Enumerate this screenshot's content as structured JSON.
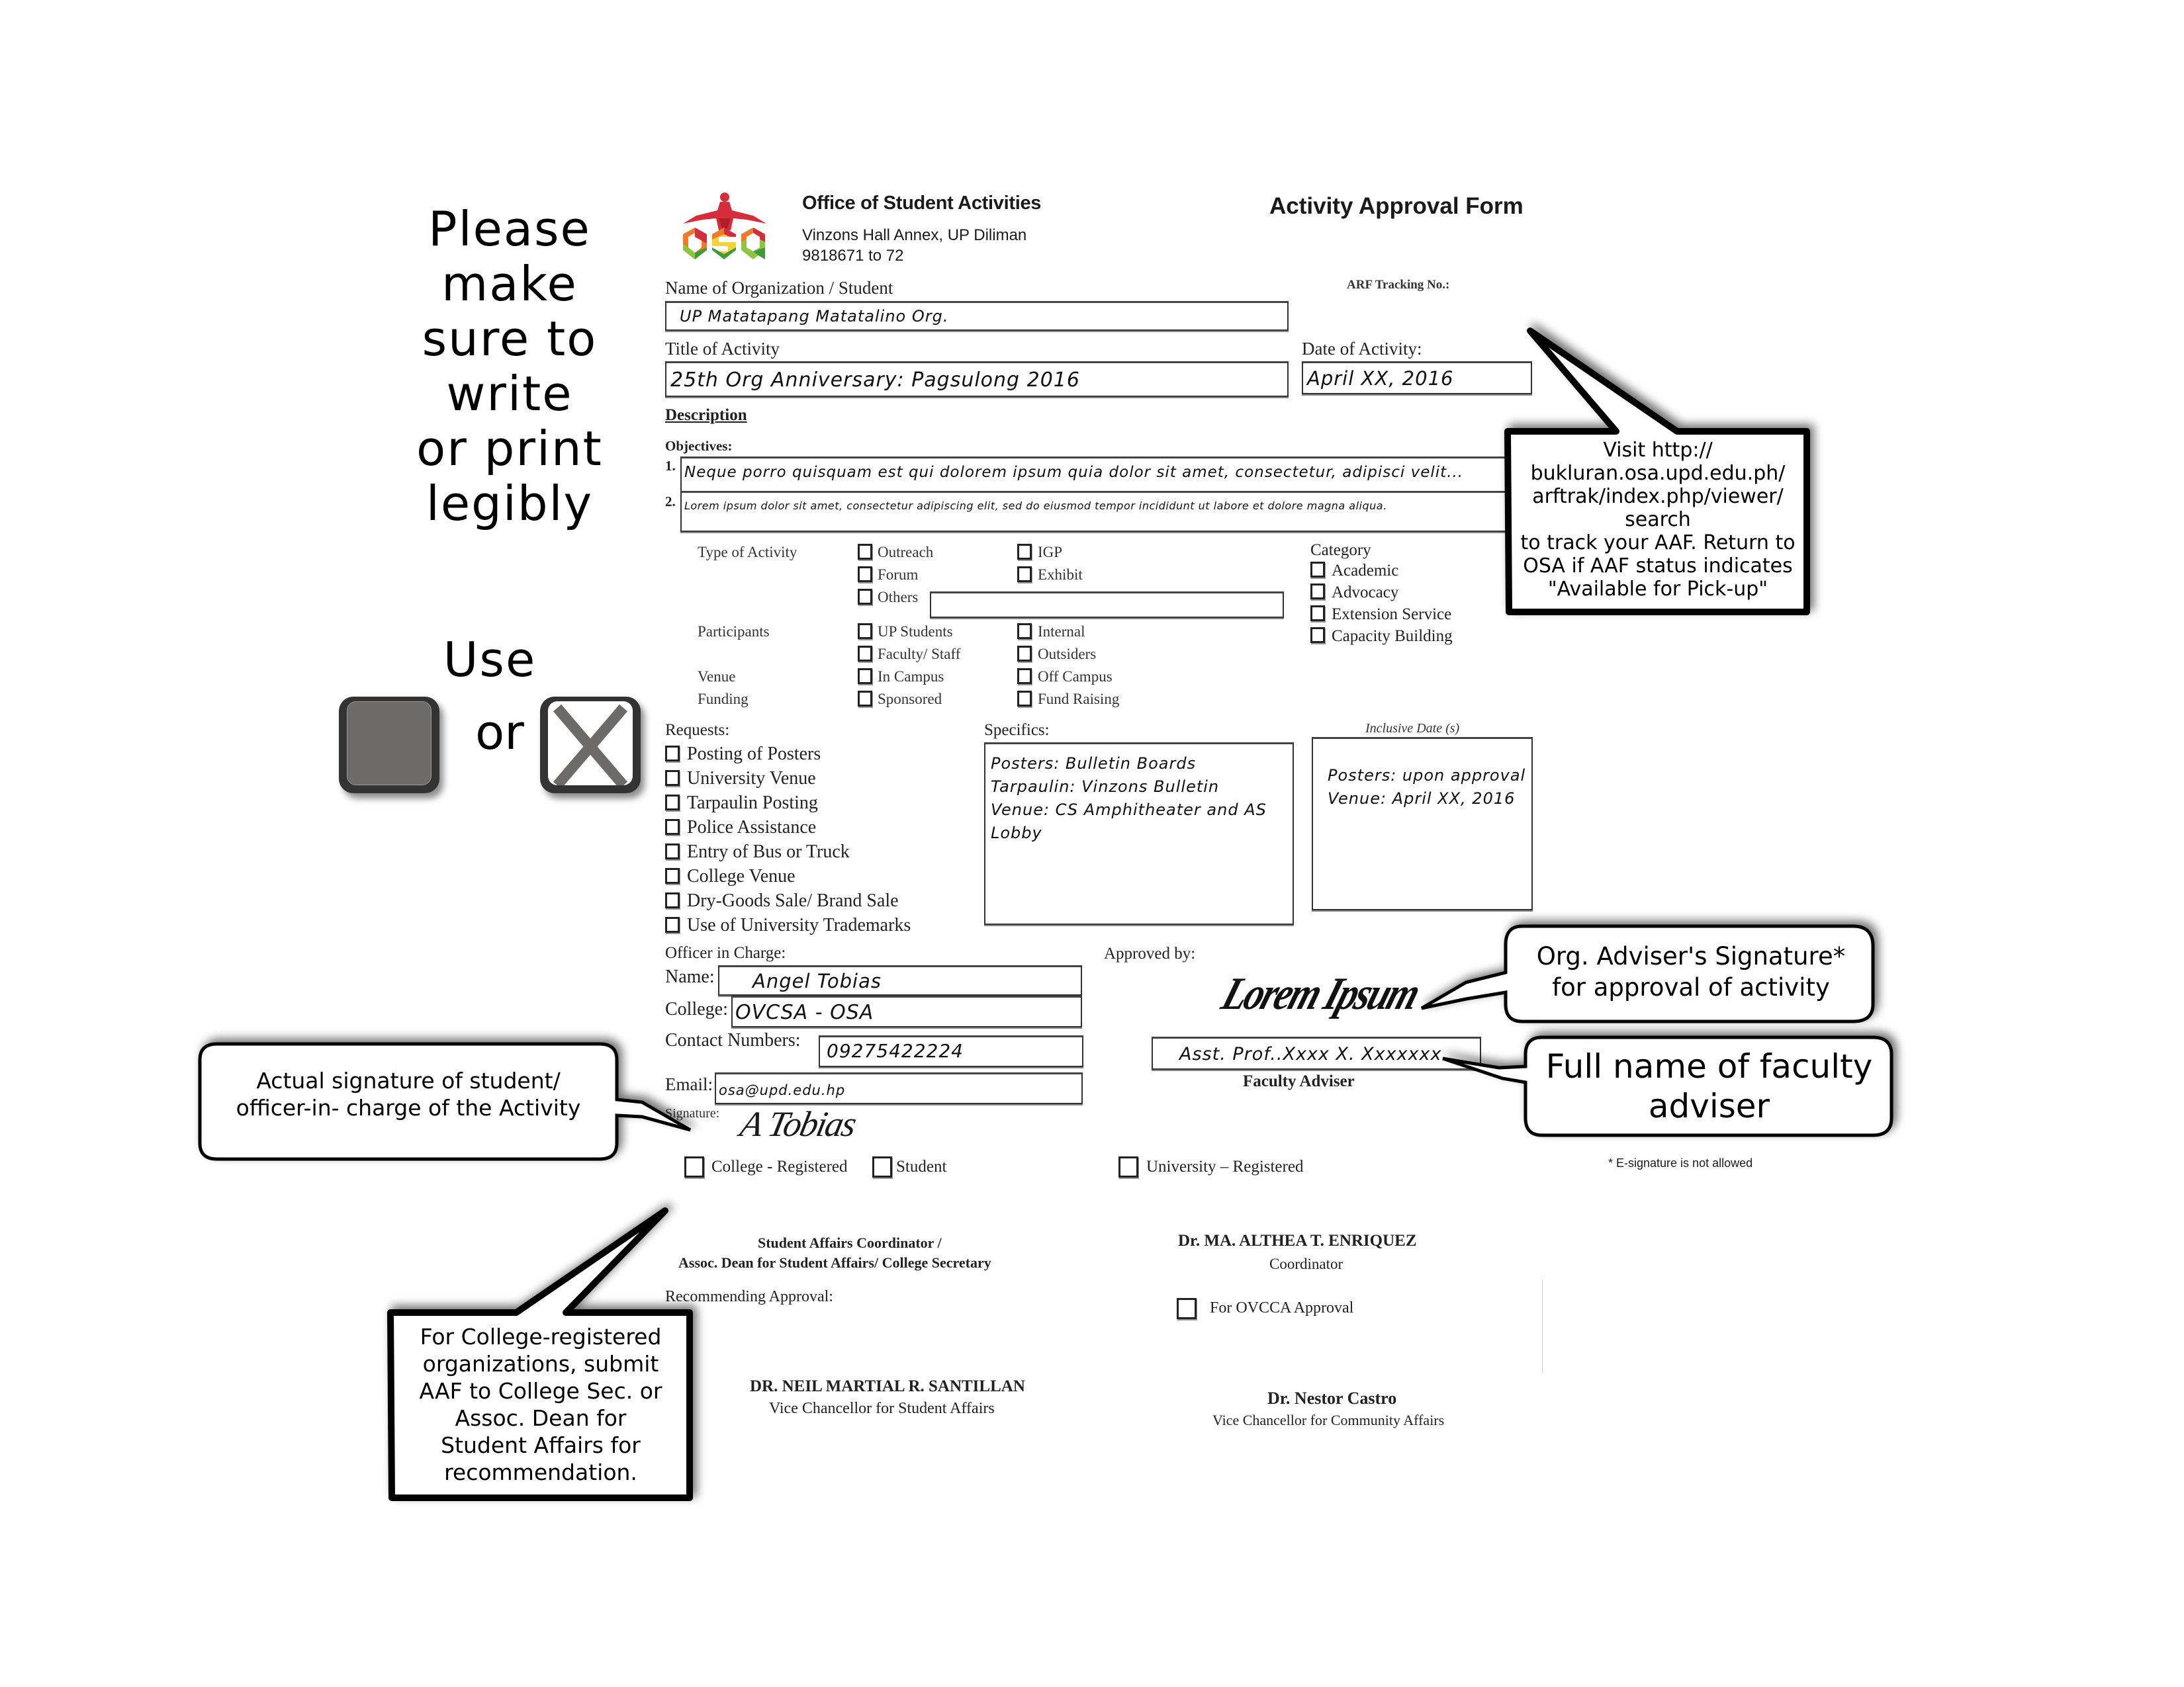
{
  "header": {
    "office_name": "Office of Student Activities",
    "office_address": "Vinzons Hall Annex, UP Diliman",
    "office_phone": "9818671 to 72",
    "form_title": "Activity Approval Form",
    "logo_text": "OSA",
    "logo_colors": [
      "#d62d3a",
      "#f07a2a",
      "#f4d33a",
      "#8cc63f",
      "#3e9a3a"
    ]
  },
  "instructions": {
    "legibility_note": [
      "Please",
      "make",
      "sure to",
      "write",
      "or print",
      "legibly"
    ],
    "use_label": "Use",
    "or_label": "or",
    "filled_box_icon": "filled-square-icon",
    "x_box_icon": "x-square-icon"
  },
  "form": {
    "org_label": "Name of Organization /  Student",
    "org_value": "UP Matatapang Matatalino Org.",
    "arf_label": "ARF Tracking No.:",
    "arf_value": "",
    "title_label": "Title of Activity",
    "title_value": "25th Org Anniversary: Pagsulong 2016",
    "date_label": "Date of Activity:",
    "date_value": "April XX, 2016",
    "description_label": "Description",
    "objectives_label": "Objectives:",
    "objectives": [
      {
        "num": "1.",
        "text": "Neque porro quisquam est qui dolorem ipsum quia dolor sit amet, consectetur, adipisci velit..."
      },
      {
        "num": "2.",
        "text": "Lorem ipsum dolor sit amet, consectetur adipiscing elit, sed do eiusmod tempor incididunt ut labore et dolore magna aliqua."
      }
    ],
    "type_of_activity_label": "Type of Activity",
    "type_options": {
      "outreach": "Outreach",
      "igp": "IGP",
      "forum": "Forum",
      "exhibit": "Exhibit",
      "others": "Others"
    },
    "others_value": "",
    "participants_label": "Participants",
    "participants_options": {
      "up_students": "UP Students",
      "internal": "Internal",
      "faculty_staff": "Faculty/ Staff",
      "outsiders": "Outsiders"
    },
    "venue_label": "Venue",
    "venue_options": {
      "in_campus": "In Campus",
      "off_campus": "Off Campus"
    },
    "funding_label": "Funding",
    "funding_options": {
      "sponsored": "Sponsored",
      "fund_raising": "Fund Raising"
    },
    "category_label": "Category",
    "category_options": [
      "Academic",
      "Advocacy",
      "Extension Service",
      "Capacity Building"
    ],
    "requests_label": "Requests:",
    "requests_options": [
      "Posting of Posters",
      "University Venue",
      "Tarpaulin Posting",
      "Police Assistance",
      "Entry of  Bus or Truck",
      "College Venue",
      "Dry-Goods Sale/ Brand Sale",
      "Use of University Trademarks"
    ],
    "specifics_label": "Specifics:",
    "specifics_lines": [
      "Posters: Bulletin Boards",
      "Tarpaulin: Vinzons Bulletin",
      "Venue: CS Amphitheater and AS",
      "Lobby"
    ],
    "inclusive_label": "Inclusive Date (s)",
    "inclusive_lines": [
      "Posters: upon approval",
      "Venue: April XX, 2016"
    ],
    "officer_label": "Officer in Charge:",
    "name_label": "Name:",
    "name_value": "Angel Tobias",
    "college_label": "College:",
    "college_value": "OVCSA - OSA",
    "contact_label": "Contact Numbers:",
    "contact_value": "09275422224",
    "email_label": "Email:",
    "email_value": "osa@upd.edu.hp",
    "signature_label": "Signature:",
    "signature_value": "A Tobias",
    "approved_by_label": "Approved by:",
    "adviser_signature": "Lorem Ipsum",
    "adviser_name_value": "Asst. Prof..Xxxx X. Xxxxxxx",
    "adviser_label": "Faculty Adviser",
    "registration_options": {
      "college": "College - Registered",
      "student": "Student",
      "university": "University – Registered"
    },
    "esignature_note": "* E-signature is not allowed",
    "sac_title_1": "Student Affairs Coordinator /",
    "sac_title_2": "Assoc. Dean for Student Affairs/ College Secretary",
    "recommending_label": "Recommending Approval:",
    "coordinator_name": "Dr. MA. ALTHEA T. ENRIQUEZ",
    "coordinator_title": "Coordinator",
    "ovcca_option": "For OVCCA Approval",
    "vcsa_name": "DR. NEIL MARTIAL R. SANTILLAN",
    "vcsa_title": "Vice Chancellor for Student Affairs",
    "vcca_name": "Dr. Nestor Castro",
    "vcca_title": "Vice Chancellor for Community Affairs"
  },
  "callouts": {
    "tracking": [
      "Visit http://",
      "bukluran.osa.upd.edu.ph/",
      "arftrak/index.php/viewer/",
      "search",
      "to track your AAF. Return to",
      "OSA if AAF status indicates",
      "\"Available for Pick-up\""
    ],
    "adviser_signature": [
      "Org. Adviser's Signature*",
      "for approval of activity"
    ],
    "adviser_name": [
      "Full name of faculty",
      "adviser"
    ],
    "student_signature": [
      "Actual signature of student/",
      "officer-in- charge of the Activity"
    ],
    "college_registered": [
      "For College-registered",
      "organizations, submit",
      "AAF to College Sec. or",
      "Assoc. Dean for",
      "Student Affairs for",
      "recommendation."
    ]
  }
}
